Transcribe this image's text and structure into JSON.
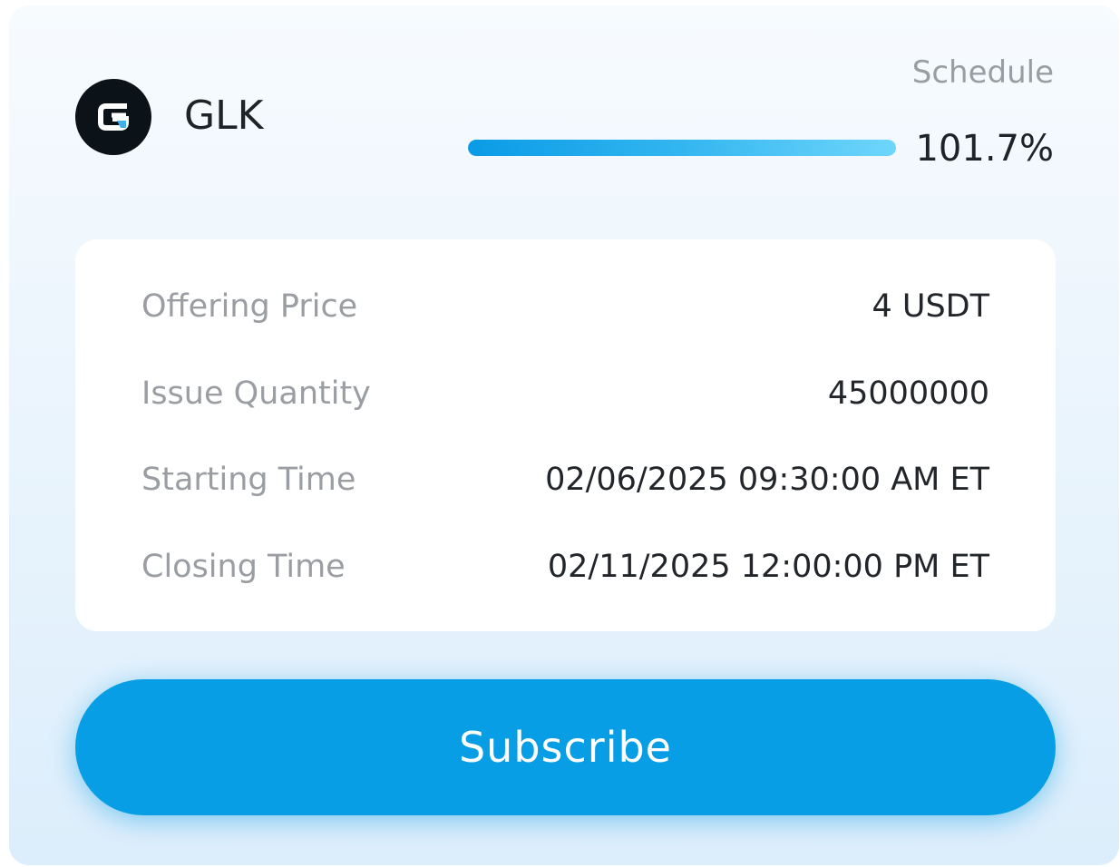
{
  "token": {
    "name": "GLK",
    "logo_icon": "glk-logo-icon"
  },
  "schedule": {
    "label": "Schedule",
    "progress_text": "101.7%",
    "progress_fraction": 1.0,
    "bar_color_start": "#0a9be6",
    "bar_color_end": "#6fd6fb"
  },
  "details": [
    {
      "label": "Offering Price",
      "value": "4 USDT"
    },
    {
      "label": "Issue Quantity",
      "value": "45000000"
    },
    {
      "label": "Starting Time",
      "value": "02/06/2025 09:30:00 AM ET"
    },
    {
      "label": "Closing Time",
      "value": "02/11/2025 12:00:00 PM ET"
    }
  ],
  "actions": {
    "subscribe_label": "Subscribe",
    "accent_color": "#079ee6"
  }
}
